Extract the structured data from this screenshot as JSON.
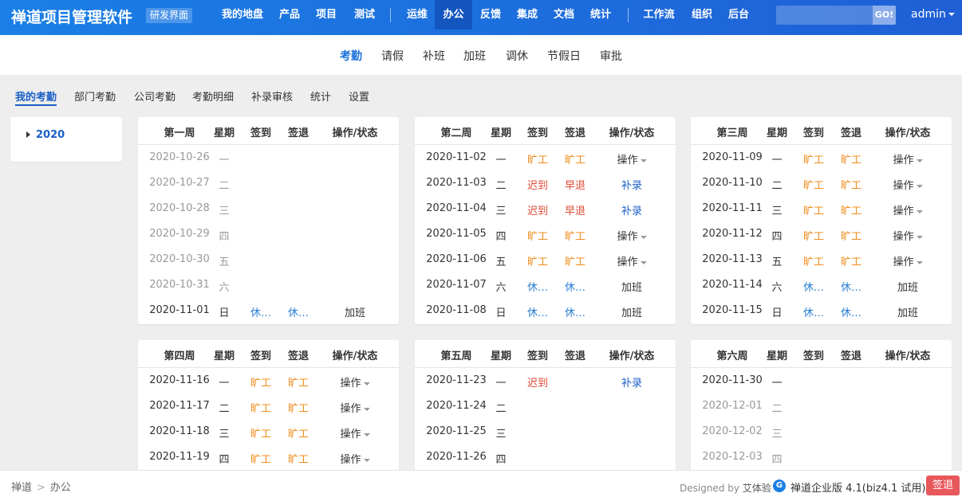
{
  "app": {
    "brand": "禅道项目管理软件",
    "brand_badge": "研发界面",
    "nav": [
      "我的地盘",
      "产品",
      "项目",
      "测试",
      "运维",
      "办公",
      "反馈",
      "集成",
      "文档",
      "统计",
      "工作流",
      "组织",
      "后台"
    ],
    "active_nav": "办公",
    "search_placeholder": "",
    "search_button": "GO!",
    "user": "admin"
  },
  "subnav": {
    "items": [
      "考勤",
      "请假",
      "补班",
      "加班",
      "调休",
      "节假日",
      "审批"
    ],
    "active": "考勤"
  },
  "tabs": {
    "items": [
      "我的考勤",
      "部门考勤",
      "公司考勤",
      "考勤明细",
      "补录审核",
      "统计",
      "设置"
    ],
    "active": "我的考勤"
  },
  "sidebar": {
    "year": "2020"
  },
  "table_headers": {
    "weekday": "星期",
    "signin": "签到",
    "signout": "签退",
    "op": "操作/状态"
  },
  "weeks": [
    {
      "title": "第一周",
      "rows": [
        {
          "date": "2020-10-26",
          "weekday": "一",
          "in": "",
          "out": "",
          "op": "",
          "past": true
        },
        {
          "date": "2020-10-27",
          "weekday": "二",
          "in": "",
          "out": "",
          "op": "",
          "past": true
        },
        {
          "date": "2020-10-28",
          "weekday": "三",
          "in": "",
          "out": "",
          "op": "",
          "past": true
        },
        {
          "date": "2020-10-29",
          "weekday": "四",
          "in": "",
          "out": "",
          "op": "",
          "past": true
        },
        {
          "date": "2020-10-30",
          "weekday": "五",
          "in": "",
          "out": "",
          "op": "",
          "past": true
        },
        {
          "date": "2020-10-31",
          "weekday": "六",
          "in": "",
          "out": "",
          "op": "",
          "past": true
        },
        {
          "date": "2020-11-01",
          "weekday": "日",
          "in": "休…",
          "out": "休…",
          "op": "加班",
          "past": false
        }
      ]
    },
    {
      "title": "第二周",
      "rows": [
        {
          "date": "2020-11-02",
          "weekday": "一",
          "in": "旷工",
          "out": "旷工",
          "op": "操作",
          "past": false
        },
        {
          "date": "2020-11-03",
          "weekday": "二",
          "in": "迟到",
          "out": "早退",
          "op": "补录",
          "past": false
        },
        {
          "date": "2020-11-04",
          "weekday": "三",
          "in": "迟到",
          "out": "早退",
          "op": "补录",
          "past": false
        },
        {
          "date": "2020-11-05",
          "weekday": "四",
          "in": "旷工",
          "out": "旷工",
          "op": "操作",
          "past": false
        },
        {
          "date": "2020-11-06",
          "weekday": "五",
          "in": "旷工",
          "out": "旷工",
          "op": "操作",
          "past": false
        },
        {
          "date": "2020-11-07",
          "weekday": "六",
          "in": "休…",
          "out": "休…",
          "op": "加班",
          "past": false
        },
        {
          "date": "2020-11-08",
          "weekday": "日",
          "in": "休…",
          "out": "休…",
          "op": "加班",
          "past": false
        }
      ]
    },
    {
      "title": "第三周",
      "rows": [
        {
          "date": "2020-11-09",
          "weekday": "一",
          "in": "旷工",
          "out": "旷工",
          "op": "操作",
          "past": false
        },
        {
          "date": "2020-11-10",
          "weekday": "二",
          "in": "旷工",
          "out": "旷工",
          "op": "操作",
          "past": false
        },
        {
          "date": "2020-11-11",
          "weekday": "三",
          "in": "旷工",
          "out": "旷工",
          "op": "操作",
          "past": false
        },
        {
          "date": "2020-11-12",
          "weekday": "四",
          "in": "旷工",
          "out": "旷工",
          "op": "操作",
          "past": false
        },
        {
          "date": "2020-11-13",
          "weekday": "五",
          "in": "旷工",
          "out": "旷工",
          "op": "操作",
          "past": false
        },
        {
          "date": "2020-11-14",
          "weekday": "六",
          "in": "休…",
          "out": "休…",
          "op": "加班",
          "past": false
        },
        {
          "date": "2020-11-15",
          "weekday": "日",
          "in": "休…",
          "out": "休…",
          "op": "加班",
          "past": false
        }
      ]
    },
    {
      "title": "第四周",
      "rows": [
        {
          "date": "2020-11-16",
          "weekday": "一",
          "in": "旷工",
          "out": "旷工",
          "op": "操作",
          "past": false
        },
        {
          "date": "2020-11-17",
          "weekday": "二",
          "in": "旷工",
          "out": "旷工",
          "op": "操作",
          "past": false
        },
        {
          "date": "2020-11-18",
          "weekday": "三",
          "in": "旷工",
          "out": "旷工",
          "op": "操作",
          "past": false
        },
        {
          "date": "2020-11-19",
          "weekday": "四",
          "in": "旷工",
          "out": "旷工",
          "op": "操作",
          "past": false
        }
      ]
    },
    {
      "title": "第五周",
      "rows": [
        {
          "date": "2020-11-23",
          "weekday": "一",
          "in": "迟到",
          "out": "",
          "op": "补录",
          "past": false
        },
        {
          "date": "2020-11-24",
          "weekday": "二",
          "in": "",
          "out": "",
          "op": "",
          "past": false
        },
        {
          "date": "2020-11-25",
          "weekday": "三",
          "in": "",
          "out": "",
          "op": "",
          "past": false
        },
        {
          "date": "2020-11-26",
          "weekday": "四",
          "in": "",
          "out": "",
          "op": "",
          "past": false
        }
      ]
    },
    {
      "title": "第六周",
      "rows": [
        {
          "date": "2020-11-30",
          "weekday": "一",
          "in": "",
          "out": "",
          "op": "",
          "past": false
        },
        {
          "date": "2020-12-01",
          "weekday": "二",
          "in": "",
          "out": "",
          "op": "",
          "past": true
        },
        {
          "date": "2020-12-02",
          "weekday": "三",
          "in": "",
          "out": "",
          "op": "",
          "past": true
        },
        {
          "date": "2020-12-03",
          "weekday": "四",
          "in": "",
          "out": "",
          "op": "",
          "past": true
        }
      ]
    }
  ],
  "footer": {
    "breadcrumb": [
      "禅道",
      "办公"
    ],
    "crumb_sep": ">",
    "designed_by_label": "Designed by",
    "designed_by": "艾体验",
    "logo_glyph": "G",
    "version": "禅道企业版 4.1(biz4.1 试用)",
    "signout": "签退"
  },
  "colors": {
    "topbar_start": "#1a7fe6",
    "topbar_end": "#1f5fd6",
    "active_blue": "#1a5fc7",
    "absent": "#f08c1a",
    "late": "#e04a37",
    "rest": "#2a7fd4",
    "signout_button": "#e7575b"
  }
}
